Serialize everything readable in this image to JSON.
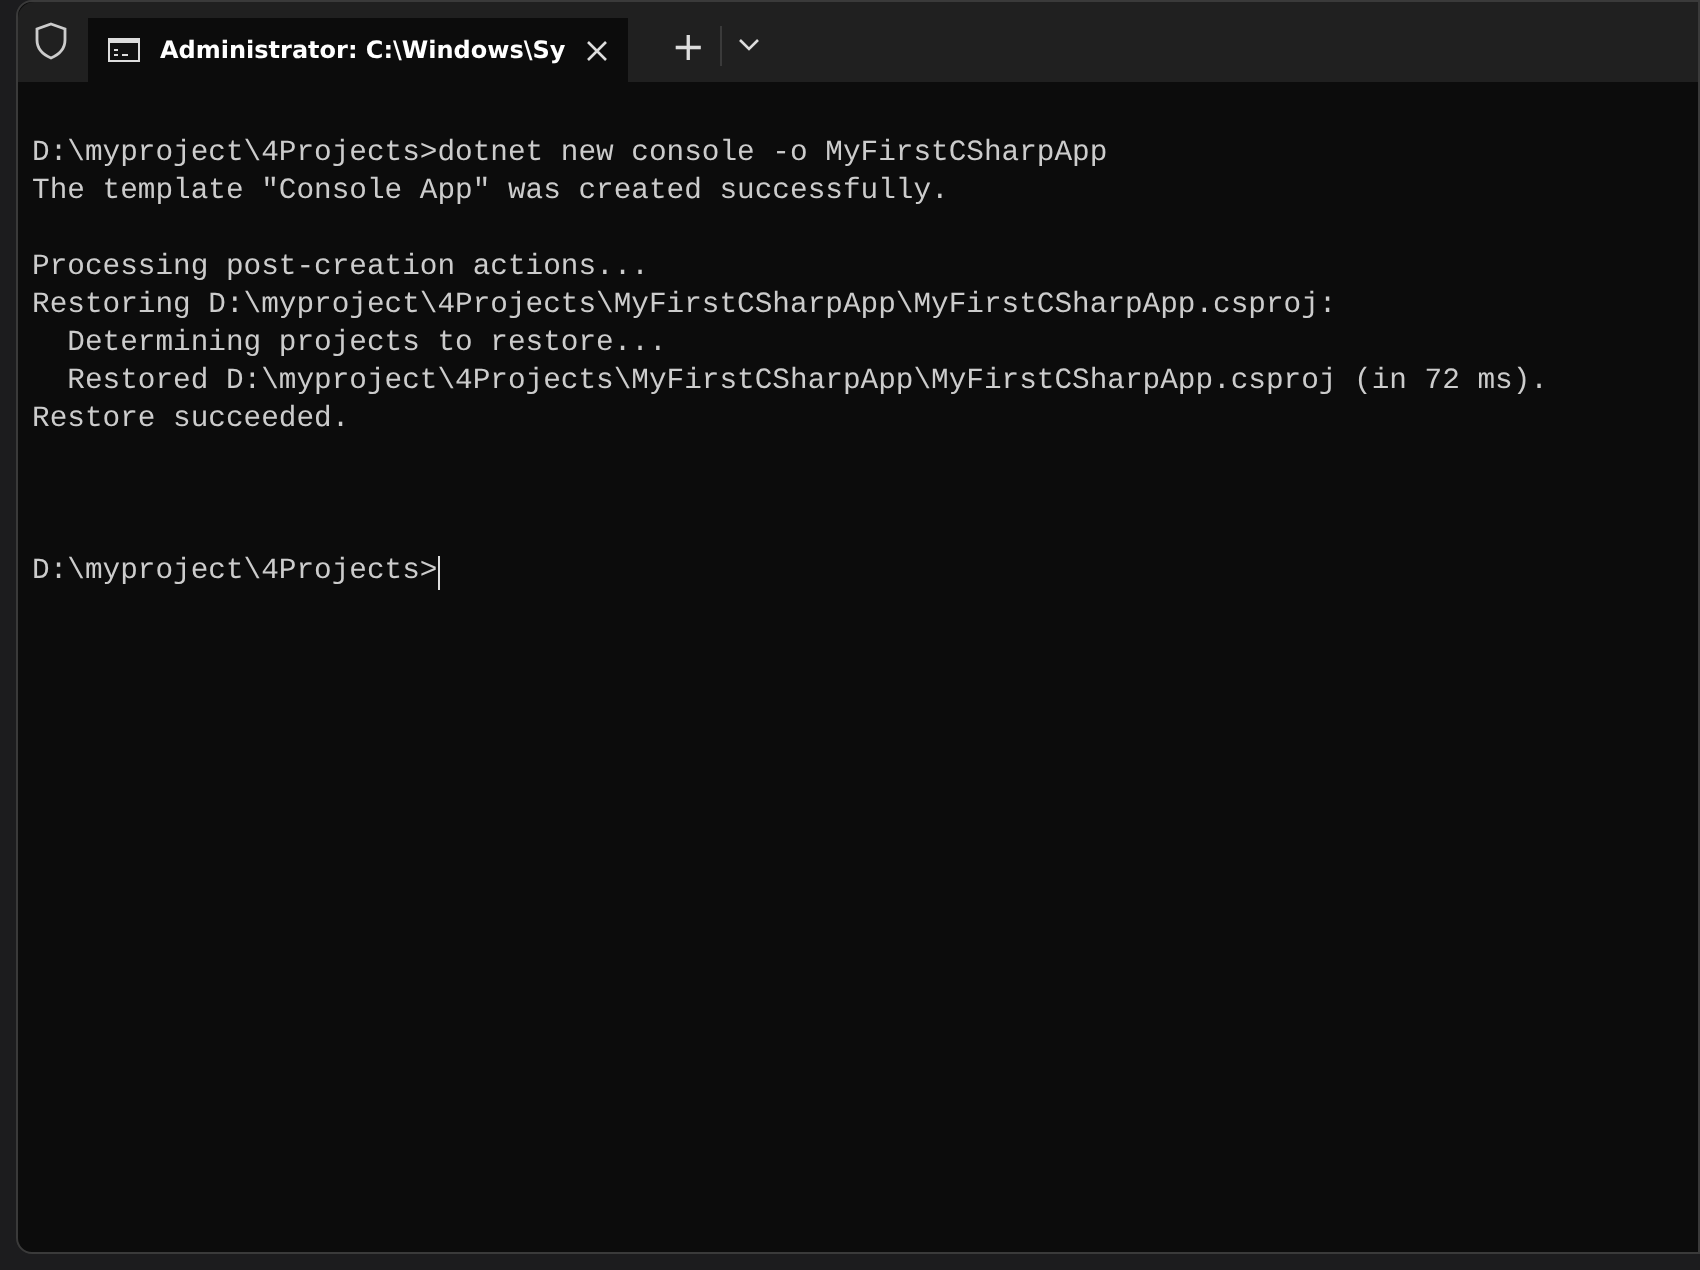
{
  "window": {
    "tab": {
      "title": "Administrator: C:\\Windows\\Sy",
      "selected": true
    }
  },
  "new_tab": "+",
  "console": {
    "lines": [
      {
        "kind": "output",
        "text": "D:\\myproject\\4Projects>dotnet new console -o MyFirstCSharpApp"
      },
      {
        "kind": "output",
        "text": "The template \"Console App\" was created successfully."
      },
      {
        "kind": "blank"
      },
      {
        "kind": "output",
        "text": "Processing post-creation actions..."
      },
      {
        "kind": "output",
        "text": "Restoring D:\\myproject\\4Projects\\MyFirstCSharpApp\\MyFirstCSharpApp.csproj:"
      },
      {
        "kind": "output",
        "text": "  Determining projects to restore..."
      },
      {
        "kind": "output",
        "text": "  Restored D:\\myproject\\4Projects\\MyFirstCSharpApp\\MyFirstCSharpApp.csproj (in 72 ms)."
      },
      {
        "kind": "output",
        "text": "Restore succeeded."
      },
      {
        "kind": "blank"
      },
      {
        "kind": "blank"
      },
      {
        "kind": "blank"
      },
      {
        "kind": "prompt",
        "text": "D:\\myproject\\4Projects>"
      }
    ]
  }
}
